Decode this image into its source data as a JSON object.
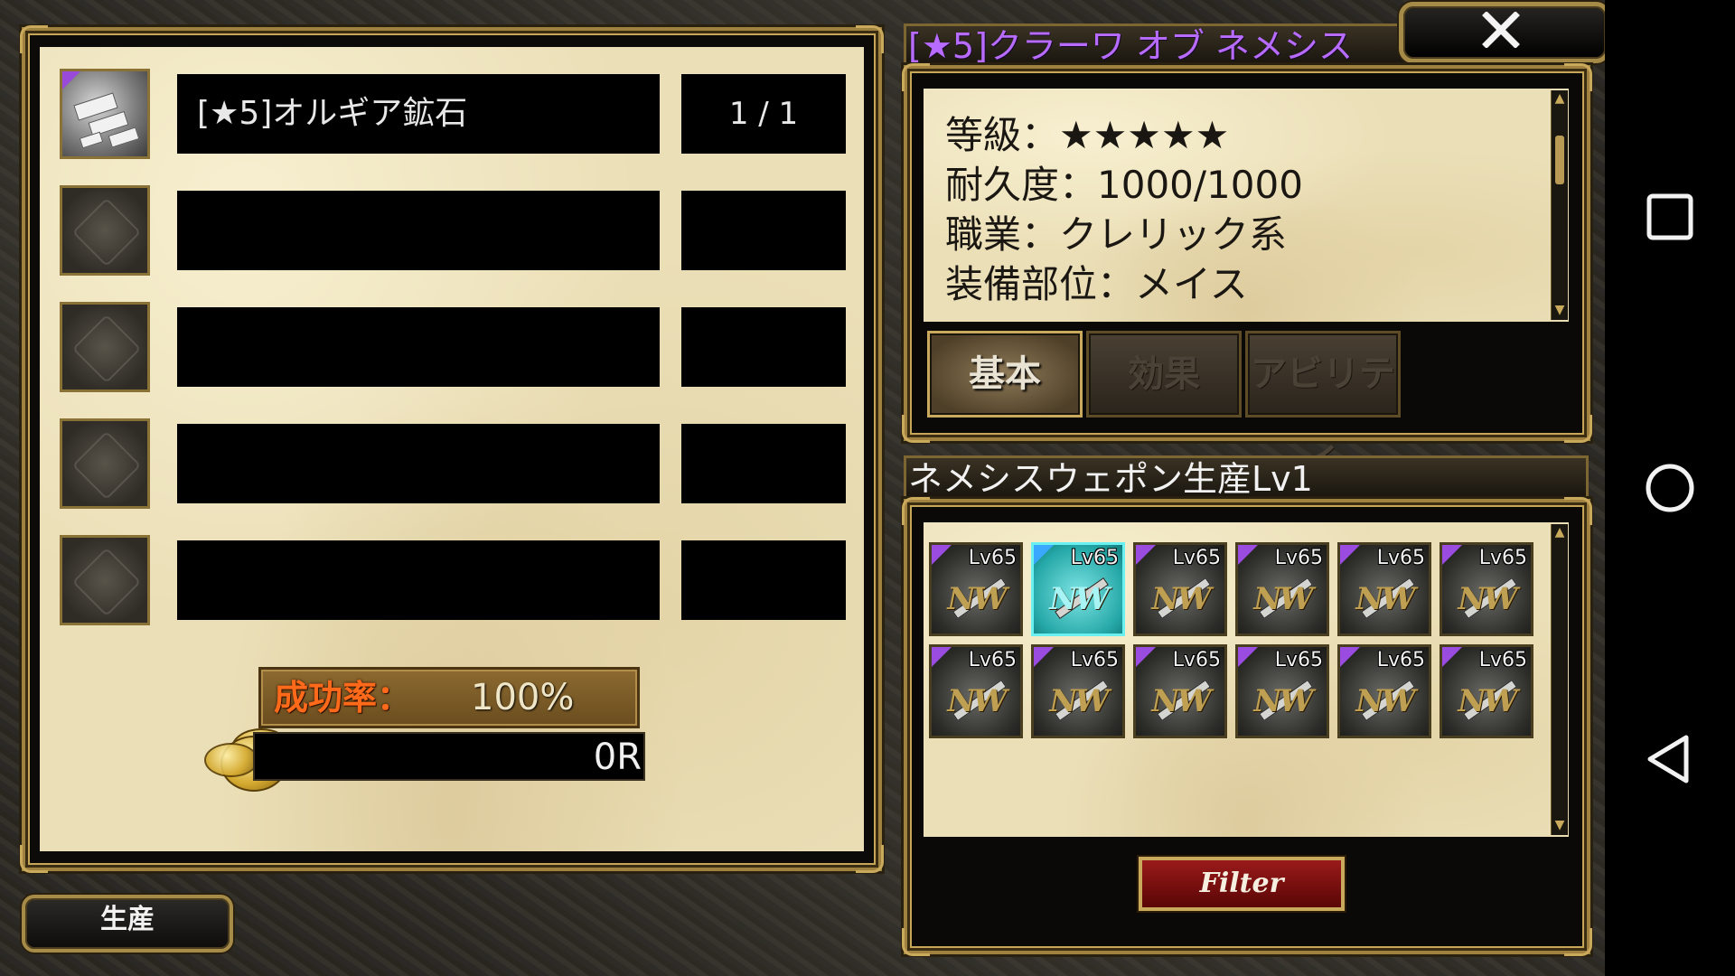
{
  "materials": {
    "rows": [
      {
        "name": "[★5]オルギア鉱石",
        "count": "1 / 1",
        "filled": true
      },
      {
        "name": "",
        "count": "",
        "filled": false
      },
      {
        "name": "",
        "count": "",
        "filled": false
      },
      {
        "name": "",
        "count": "",
        "filled": false
      },
      {
        "name": "",
        "count": "",
        "filled": false
      }
    ],
    "success_label": "成功率：",
    "success_value": "100%",
    "cost_value": "0R"
  },
  "produce_button": "生産",
  "item_detail": {
    "title": "[★5]クラーワ オブ ネメシス",
    "lines": [
      "等級：★★★★★",
      "耐久度：1000/1000",
      "職業：クレリック系",
      "装備部位：メイス"
    ],
    "tabs": [
      "基本",
      "効果",
      "アビリティ"
    ],
    "active_tab": "基本"
  },
  "production": {
    "title": "ネメシスウェポン生産Lv1",
    "weapons": [
      {
        "level": "Lv65",
        "badge": "NW",
        "selected": false
      },
      {
        "level": "Lv65",
        "badge": "NW",
        "selected": true
      },
      {
        "level": "Lv65",
        "badge": "NW",
        "selected": false
      },
      {
        "level": "Lv65",
        "badge": "NW",
        "selected": false
      },
      {
        "level": "Lv65",
        "badge": "NW",
        "selected": false
      },
      {
        "level": "Lv65",
        "badge": "NW",
        "selected": false
      },
      {
        "level": "Lv65",
        "badge": "NW",
        "selected": false
      },
      {
        "level": "Lv65",
        "badge": "NW",
        "selected": false
      },
      {
        "level": "Lv65",
        "badge": "NW",
        "selected": false
      },
      {
        "level": "Lv65",
        "badge": "NW",
        "selected": false
      },
      {
        "level": "Lv65",
        "badge": "NW",
        "selected": false
      },
      {
        "level": "Lv65",
        "badge": "NW",
        "selected": false
      }
    ],
    "filter_label": "Filter"
  },
  "icons": {
    "close": "close-icon",
    "coin": "coin-icon",
    "ore": "ore-icon",
    "empty_slot": "empty-slot-icon",
    "nav": [
      "recents-icon",
      "home-icon",
      "back-icon"
    ]
  },
  "colors": {
    "item_title": "#b76bff",
    "success_label": "#ff6a1a",
    "selected_weapon": "#26a8a8",
    "filter_button": "#9a1a1a",
    "frame_gold": "#9f8240"
  }
}
